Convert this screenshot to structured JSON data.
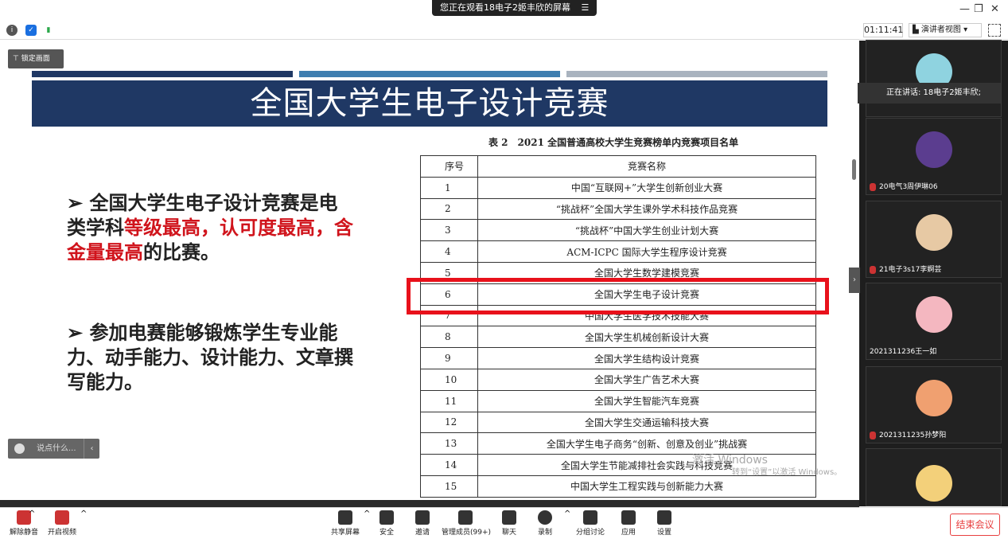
{
  "top": {
    "share_notice": "您正在观看18电子2姬丰欣的屏幕",
    "menu_glyph": "☰"
  },
  "window": {
    "minimize": "—",
    "restore": "❐",
    "close": "✕"
  },
  "toolbar": {
    "timer": "01:11:41",
    "view_button": "演讲者视图",
    "view_caret": "▾"
  },
  "content": {
    "lock_button": "锁定画面",
    "title": "全国大学生电子设计竞赛",
    "stripes": [
      "#1f3864",
      "#3f7eb0",
      "#a9b3bf"
    ],
    "bullet1_plain1": "全国大学生电子设计竞赛是电类学科",
    "bullet1_red": "等级最高，认可度最高，含金量最高",
    "bullet1_plain2": "的比赛。",
    "bullet2": "参加电赛能够锻炼学生专业能力、动手能力、设计能力、文章撰写能力。",
    "bullet_marker": "➢",
    "table_caption": "表 2　2021 全国普通高校大学生竞赛榜单内竞赛项目名单",
    "table_headers": [
      "序号",
      "竞赛名称"
    ],
    "table_rows": [
      [
        "1",
        "中国“互联网+”大学生创新创业大赛"
      ],
      [
        "2",
        "“挑战杯”全国大学生课外学术科技作品竞赛"
      ],
      [
        "3",
        "“挑战杯”中国大学生创业计划大赛"
      ],
      [
        "4",
        "ACM-ICPC 国际大学生程序设计竞赛"
      ],
      [
        "5",
        "全国大学生数学建模竞赛"
      ],
      [
        "6",
        "全国大学生电子设计竞赛"
      ],
      [
        "7",
        "中国大学生医学技术技能大赛"
      ],
      [
        "8",
        "全国大学生机械创新设计大赛"
      ],
      [
        "9",
        "全国大学生结构设计竞赛"
      ],
      [
        "10",
        "全国大学生广告艺术大赛"
      ],
      [
        "11",
        "全国大学生智能汽车竞赛"
      ],
      [
        "12",
        "全国大学生交通运输科技大赛"
      ],
      [
        "13",
        "全国大学生电子商务“创新、创意及创业”挑战赛"
      ],
      [
        "14",
        "全国大学生节能减排社会实践与科技竞赛"
      ],
      [
        "15",
        "中国大学生工程实践与创新能力大赛"
      ]
    ],
    "highlight_color": "#e8111b",
    "watermark": "激活 Windows",
    "watermark_sub": "转到“设置”以激活 Windows。",
    "chat_placeholder": "说点什么...",
    "chat_chevron": "‹"
  },
  "panel": {
    "speaker": "正在讲话: 18电子2姬丰欣;",
    "collapse": "›",
    "participants": [
      {
        "name": "",
        "avatar_color": "#8fd3e0"
      },
      {
        "name": "20电气3周伊琳06",
        "avatar_color": "#5b3d8f"
      },
      {
        "name": "21电子3s17李婀芸",
        "avatar_color": "#e7c9a4"
      },
      {
        "name": "2021311236王一如",
        "avatar_color": "#f4b7c0"
      },
      {
        "name": "2021311235孙梦阳",
        "avatar_color": "#f0a070"
      },
      {
        "name": "",
        "avatar_color": "#f3d07a"
      }
    ]
  },
  "bottom": {
    "unmute": "解除静音",
    "video": "开启视频",
    "share": "共享屏幕",
    "security": "安全",
    "invite": "邀请",
    "members": "管理成员(99+)",
    "chat": "聊天",
    "record": "录制",
    "breakout": "分组讨论",
    "apps": "应用",
    "settings": "设置",
    "end": "结束会议",
    "caret": "^"
  }
}
